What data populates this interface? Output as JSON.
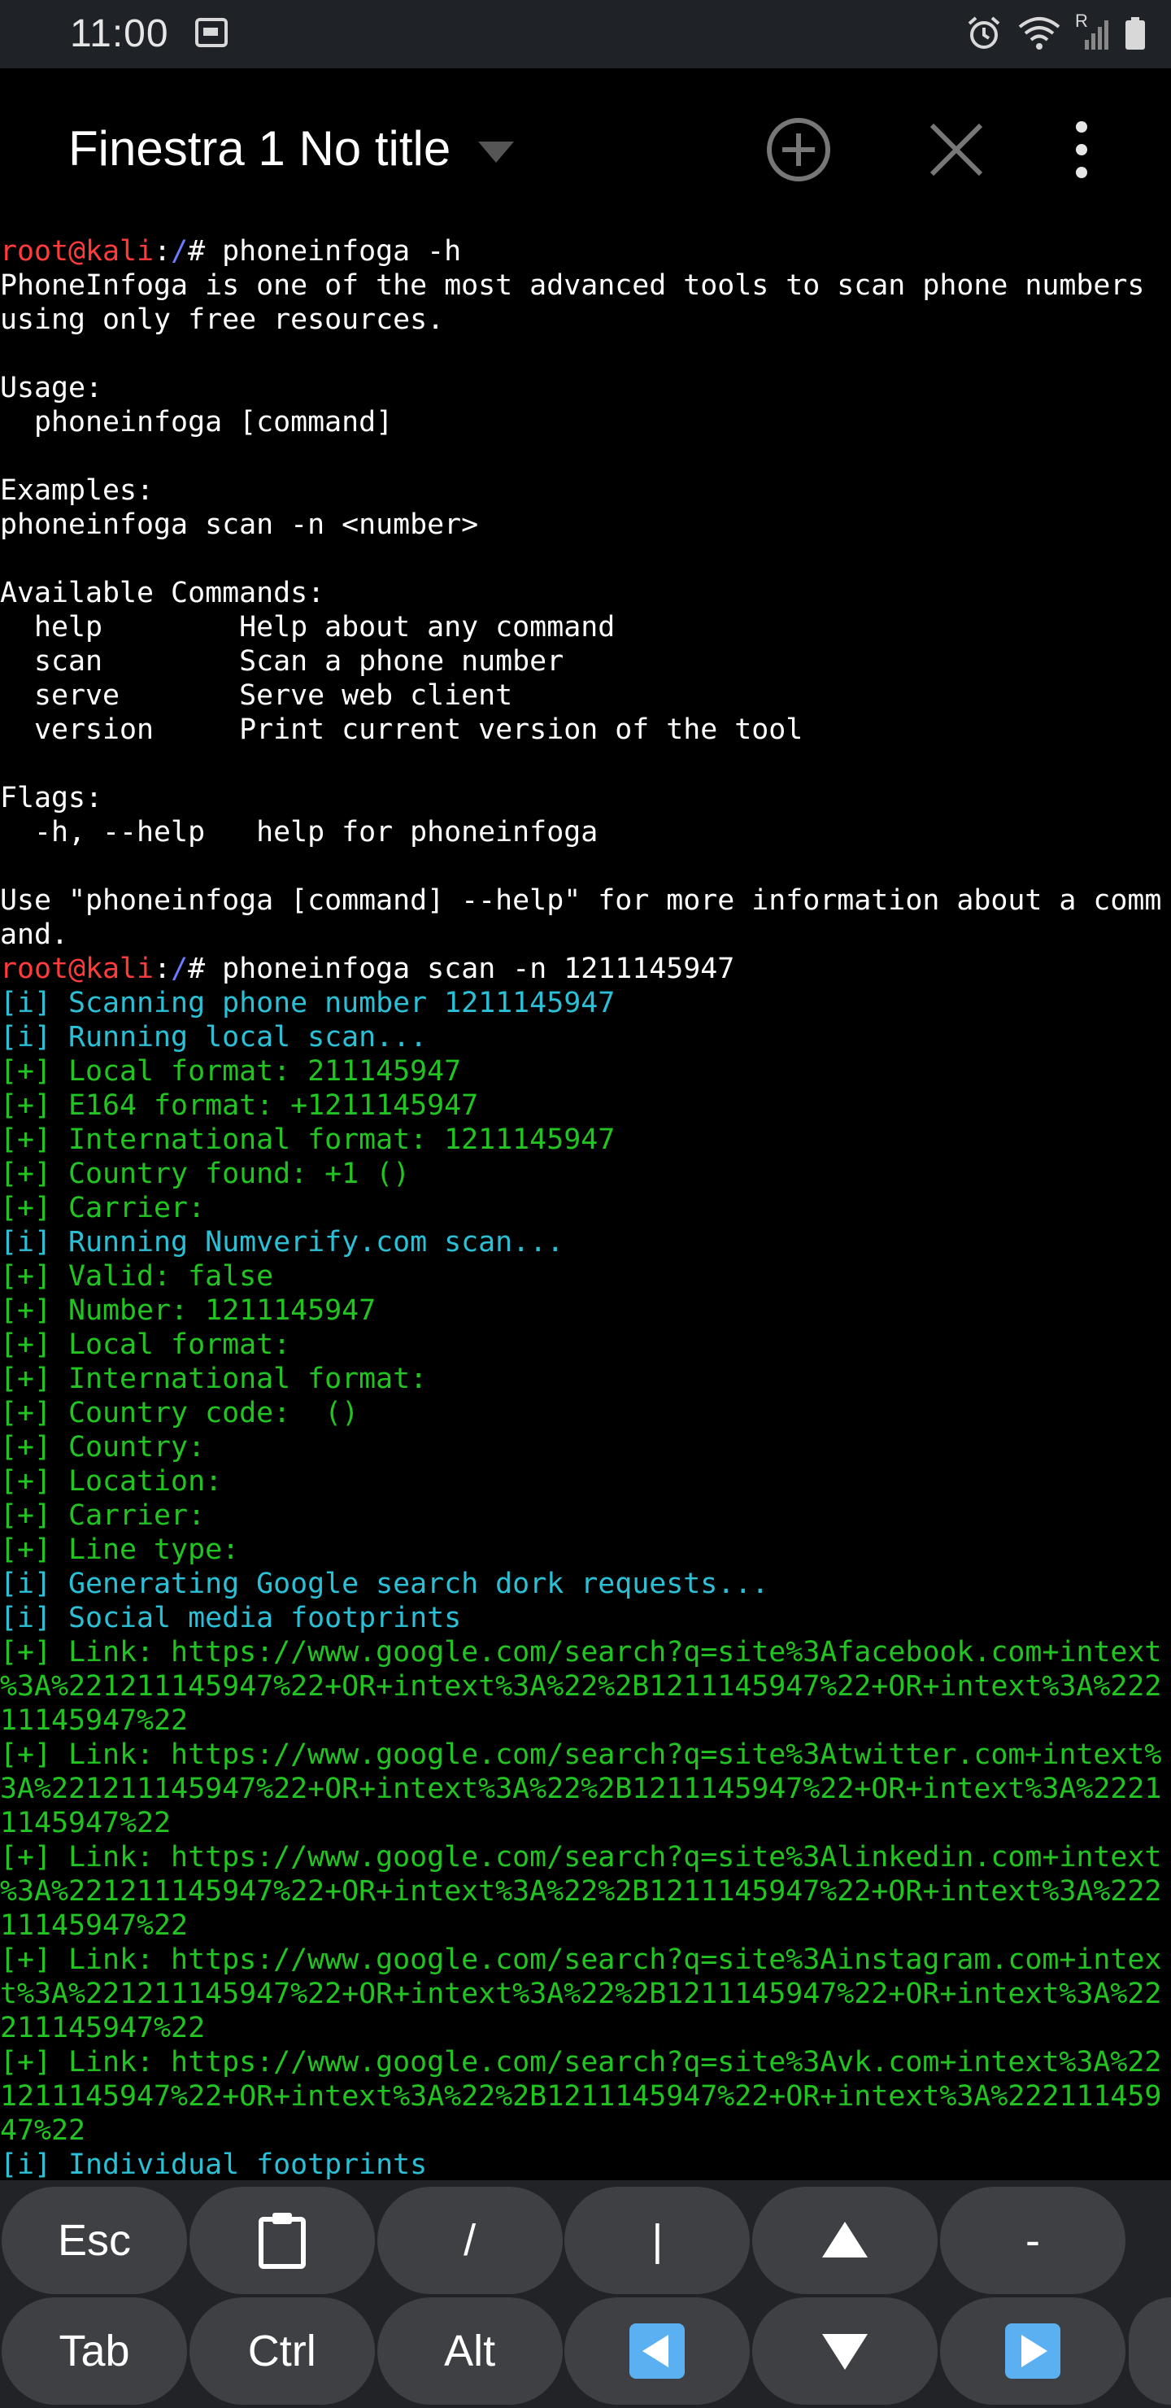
{
  "status_bar": {
    "time": "11:00",
    "roaming_indicator": "R",
    "icons": [
      "sim-card-icon",
      "alarm-icon",
      "wifi-icon",
      "signal-icon",
      "battery-icon"
    ]
  },
  "app_bar": {
    "title": "Finestra 1 No title",
    "icons": [
      "dropdown-arrow-icon",
      "add-circle-icon",
      "close-icon",
      "more-vert-icon"
    ]
  },
  "terminal": {
    "lines": [
      {
        "type": "prompt",
        "user": "root@kali",
        "sep": ":",
        "path": "/",
        "cmd": "# phoneinfoga -h"
      },
      {
        "type": "text",
        "text": "PhoneInfoga is one of the most advanced tools to scan phone numbers"
      },
      {
        "type": "text",
        "text": "using only free resources."
      },
      {
        "type": "text",
        "text": ""
      },
      {
        "type": "text",
        "text": "Usage:"
      },
      {
        "type": "text",
        "text": "  phoneinfoga [command]"
      },
      {
        "type": "text",
        "text": ""
      },
      {
        "type": "text",
        "text": "Examples:"
      },
      {
        "type": "text",
        "text": "phoneinfoga scan -n <number>"
      },
      {
        "type": "text",
        "text": ""
      },
      {
        "type": "text",
        "text": "Available Commands:"
      },
      {
        "type": "text",
        "text": "  help        Help about any command"
      },
      {
        "type": "text",
        "text": "  scan        Scan a phone number"
      },
      {
        "type": "text",
        "text": "  serve       Serve web client"
      },
      {
        "type": "text",
        "text": "  version     Print current version of the tool"
      },
      {
        "type": "text",
        "text": ""
      },
      {
        "type": "text",
        "text": "Flags:"
      },
      {
        "type": "text",
        "text": "  -h, --help   help for phoneinfoga"
      },
      {
        "type": "text",
        "text": ""
      },
      {
        "type": "text",
        "text": "Use \"phoneinfoga [command] --help\" for more information about a comm"
      },
      {
        "type": "text",
        "text": "and."
      },
      {
        "type": "prompt",
        "user": "root@kali",
        "sep": ":",
        "path": "/",
        "cmd": "# phoneinfoga scan -n 1211145947"
      },
      {
        "type": "info",
        "text": "[i] Scanning phone number 1211145947"
      },
      {
        "type": "info",
        "text": "[i] Running local scan..."
      },
      {
        "type": "plus",
        "text": "[+] Local format: 211145947"
      },
      {
        "type": "plus",
        "text": "[+] E164 format: +1211145947"
      },
      {
        "type": "plus",
        "text": "[+] International format: 1211145947"
      },
      {
        "type": "plus",
        "text": "[+] Country found: +1 ()"
      },
      {
        "type": "plus",
        "text": "[+] Carrier:"
      },
      {
        "type": "info",
        "text": "[i] Running Numverify.com scan..."
      },
      {
        "type": "plus",
        "text": "[+] Valid: false"
      },
      {
        "type": "plus",
        "text": "[+] Number: 1211145947"
      },
      {
        "type": "plus",
        "text": "[+] Local format:"
      },
      {
        "type": "plus",
        "text": "[+] International format:"
      },
      {
        "type": "plus",
        "text": "[+] Country code:  ()"
      },
      {
        "type": "plus",
        "text": "[+] Country:"
      },
      {
        "type": "plus",
        "text": "[+] Location:"
      },
      {
        "type": "plus",
        "text": "[+] Carrier:"
      },
      {
        "type": "plus",
        "text": "[+] Line type:"
      },
      {
        "type": "info",
        "text": "[i] Generating Google search dork requests..."
      },
      {
        "type": "info",
        "text": "[i] Social media footprints"
      },
      {
        "type": "plus",
        "text": "[+] Link: https://www.google.com/search?q=site%3Afacebook.com+intext"
      },
      {
        "type": "plus",
        "text": "%3A%221211145947%22+OR+intext%3A%22%2B1211145947%22+OR+intext%3A%222"
      },
      {
        "type": "plus",
        "text": "11145947%22"
      },
      {
        "type": "plus",
        "text": "[+] Link: https://www.google.com/search?q=site%3Atwitter.com+intext%"
      },
      {
        "type": "plus",
        "text": "3A%221211145947%22+OR+intext%3A%22%2B1211145947%22+OR+intext%3A%2221"
      },
      {
        "type": "plus",
        "text": "1145947%22"
      },
      {
        "type": "plus",
        "text": "[+] Link: https://www.google.com/search?q=site%3Alinkedin.com+intext"
      },
      {
        "type": "plus",
        "text": "%3A%221211145947%22+OR+intext%3A%22%2B1211145947%22+OR+intext%3A%222"
      },
      {
        "type": "plus",
        "text": "11145947%22"
      },
      {
        "type": "plus",
        "text": "[+] Link: https://www.google.com/search?q=site%3Ainstagram.com+intex"
      },
      {
        "type": "plus",
        "text": "t%3A%221211145947%22+OR+intext%3A%22%2B1211145947%22+OR+intext%3A%22"
      },
      {
        "type": "plus",
        "text": "211145947%22"
      },
      {
        "type": "plus",
        "text": "[+] Link: https://www.google.com/search?q=site%3Avk.com+intext%3A%22"
      },
      {
        "type": "plus",
        "text": "1211145947%22+OR+intext%3A%22%2B1211145947%22+OR+intext%3A%222111459"
      },
      {
        "type": "plus",
        "text": "47%22"
      },
      {
        "type": "info",
        "text": "[i] Individual footprints"
      }
    ]
  },
  "extra_keys": {
    "row1": [
      {
        "label": "Esc",
        "name": "esc-key"
      },
      {
        "label": "",
        "name": "paste-key",
        "icon": "clipboard-icon"
      },
      {
        "label": "/",
        "name": "slash-key"
      },
      {
        "label": "|",
        "name": "pipe-key"
      },
      {
        "label": "",
        "name": "up-arrow-key",
        "icon": "arrow-up-icon"
      },
      {
        "label": "-",
        "name": "dash-key"
      }
    ],
    "row2": [
      {
        "label": "Tab",
        "name": "tab-key"
      },
      {
        "label": "Ctrl",
        "name": "ctrl-key"
      },
      {
        "label": "Alt",
        "name": "alt-key"
      },
      {
        "label": "",
        "name": "left-arrow-key",
        "icon": "arrow-left-icon"
      },
      {
        "label": "",
        "name": "down-arrow-key",
        "icon": "arrow-down-icon"
      },
      {
        "label": "",
        "name": "right-arrow-key",
        "icon": "arrow-right-icon"
      }
    ]
  },
  "colors": {
    "prompt_user": "#ff3b3b",
    "prompt_path": "#6a7cff",
    "info": "#2bc0d6",
    "success": "#22c422",
    "key_bg": "#3f4043",
    "arrow_blue": "#5ab0f0"
  }
}
